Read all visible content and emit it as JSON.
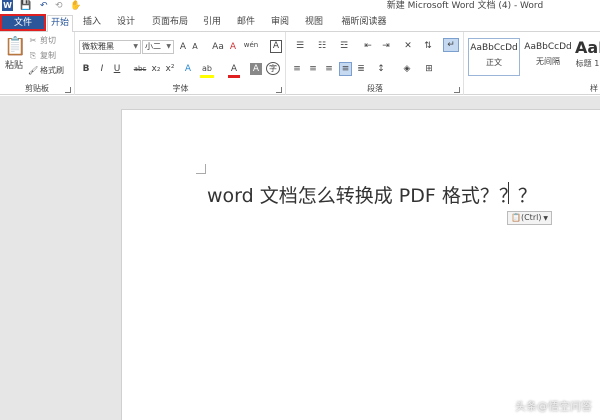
{
  "window": {
    "title": "新建 Microsoft Word 文档 (4) - Word"
  },
  "qat": {
    "word_logo": "W",
    "save": "save-icon",
    "undo": "undo-icon",
    "redo": "redo-icon",
    "touch": "touch-mode-icon"
  },
  "tabs": {
    "file": "文件",
    "home": "开始",
    "insert": "插入",
    "design": "设计",
    "layout": "页面布局",
    "references": "引用",
    "mailings": "邮件",
    "review": "审阅",
    "view": "视图",
    "foxit": "福昕阅读器"
  },
  "clipboard": {
    "paste": "粘贴",
    "cut": "剪切",
    "copy": "复制",
    "format_painter": "格式刷",
    "label": "剪贴板"
  },
  "font": {
    "family": "微软雅黑",
    "size": "小二",
    "grow": "A",
    "shrink": "A",
    "case": "Aa",
    "clear": "A",
    "phonetic": "wén",
    "border": "A",
    "bold": "B",
    "italic": "I",
    "underline": "U",
    "strike": "abc",
    "sub": "x₂",
    "sup": "x²",
    "effects": "A",
    "highlight": "ab",
    "color": "A",
    "shade": "A",
    "circle": "字",
    "label": "字体"
  },
  "paragraph": {
    "label": "段落"
  },
  "styles": {
    "normal_preview": "AaBbCcDd",
    "normal_name": "正文",
    "nospace_preview": "AaBbCcDd",
    "nospace_name": "无间隔",
    "h1_preview": "AaB",
    "h1_name": "标题 1",
    "more": "样"
  },
  "document": {
    "text": "word 文档怎么转换成 PDF 格式？？？",
    "paste_options": "(Ctrl)"
  },
  "watermark": "头条@悟空问答",
  "colors": {
    "accent": "#2b579a",
    "file_border": "#e02020"
  }
}
